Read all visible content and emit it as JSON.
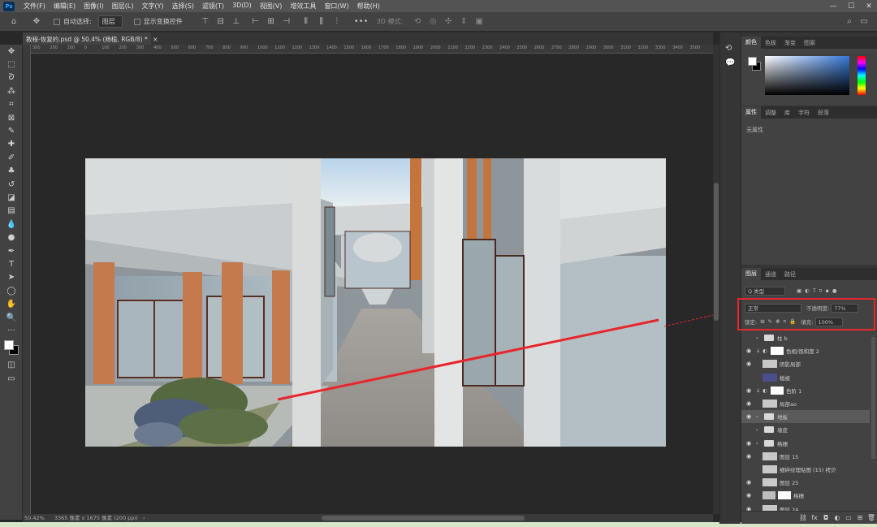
{
  "app": {
    "logo": "Ps"
  },
  "menu": [
    "文件(F)",
    "编辑(E)",
    "图像(I)",
    "图层(L)",
    "文字(Y)",
    "选择(S)",
    "滤镜(T)",
    "3D(D)",
    "视图(V)",
    "增效工具",
    "窗口(W)",
    "帮助(H)"
  ],
  "window_controls": {
    "minimize": "—",
    "maximize": "☐",
    "close": "✕"
  },
  "options_bar": {
    "auto_select_label": "自动选择:",
    "auto_select_value": "图层",
    "transform_label": "显示变换控件",
    "mode_label": "3D 模式:"
  },
  "document": {
    "tab_title": "教程-恢复的.psd @ 50.4% (杨植, RGB/8) *",
    "close": "×"
  },
  "ruler_labels": [
    "300",
    "200",
    "100",
    "0",
    "100",
    "200",
    "300",
    "400",
    "500",
    "600",
    "700",
    "800",
    "900",
    "1000",
    "1100",
    "1200",
    "1300",
    "1400",
    "1500",
    "1600",
    "1700",
    "1800",
    "1900",
    "2000",
    "2100",
    "2200",
    "2300",
    "2400",
    "2500",
    "2600",
    "2700",
    "2800",
    "2900",
    "3000",
    "3100",
    "3200",
    "3300",
    "3400",
    "3500"
  ],
  "status": {
    "zoom": "50.42%",
    "doc_info": "3365 像素 x 1675 像素 (200 ppi)"
  },
  "color_panel": {
    "tabs": [
      "颜色",
      "色板",
      "渐变",
      "图案"
    ],
    "active": 0
  },
  "properties_panel": {
    "tabs": [
      "属性",
      "调整",
      "库",
      "字符",
      "段落"
    ],
    "active": 0,
    "empty_text": "无属性"
  },
  "layers_panel": {
    "tabs": [
      "图层",
      "通道",
      "路径"
    ],
    "active": 0,
    "filter_label": "Q 类型",
    "blend_mode": "正常",
    "opacity_label": "不透明度:",
    "opacity_value": "77%",
    "lock_label": "锁定:",
    "fill_label": "填充:",
    "fill_value": "100%",
    "layers": [
      {
        "name": "柱 b",
        "visible": false,
        "kind": "group"
      },
      {
        "name": "色相/饱和度 2",
        "visible": true,
        "kind": "adjustment"
      },
      {
        "name": "阴影局部",
        "visible": true,
        "kind": "image"
      },
      {
        "name": "植被",
        "visible": false,
        "kind": "image"
      },
      {
        "name": "色阶 1",
        "visible": true,
        "kind": "adjustment"
      },
      {
        "name": "局部ao",
        "visible": true,
        "kind": "image"
      },
      {
        "name": "地板",
        "visible": true,
        "kind": "group",
        "selected": true
      },
      {
        "name": "墙皮",
        "visible": false,
        "kind": "group"
      },
      {
        "name": "格栅",
        "visible": true,
        "kind": "group"
      },
      {
        "name": "图层 15",
        "visible": true,
        "kind": "image"
      },
      {
        "name": "细碎纹理贴图 (15) 拷贝",
        "visible": false,
        "kind": "image"
      },
      {
        "name": "图层 25",
        "visible": true,
        "kind": "image"
      },
      {
        "name": "格栅",
        "visible": true,
        "kind": "masked"
      },
      {
        "name": "图层 24",
        "visible": true,
        "kind": "image"
      }
    ],
    "footer_icons": [
      "link-icon",
      "fx-icon",
      "mask-icon",
      "adjustment-icon",
      "group-icon",
      "new-layer-icon",
      "trash-icon"
    ]
  },
  "colors": {
    "highlight": "#e8252a",
    "accent": "#31a8ff"
  }
}
